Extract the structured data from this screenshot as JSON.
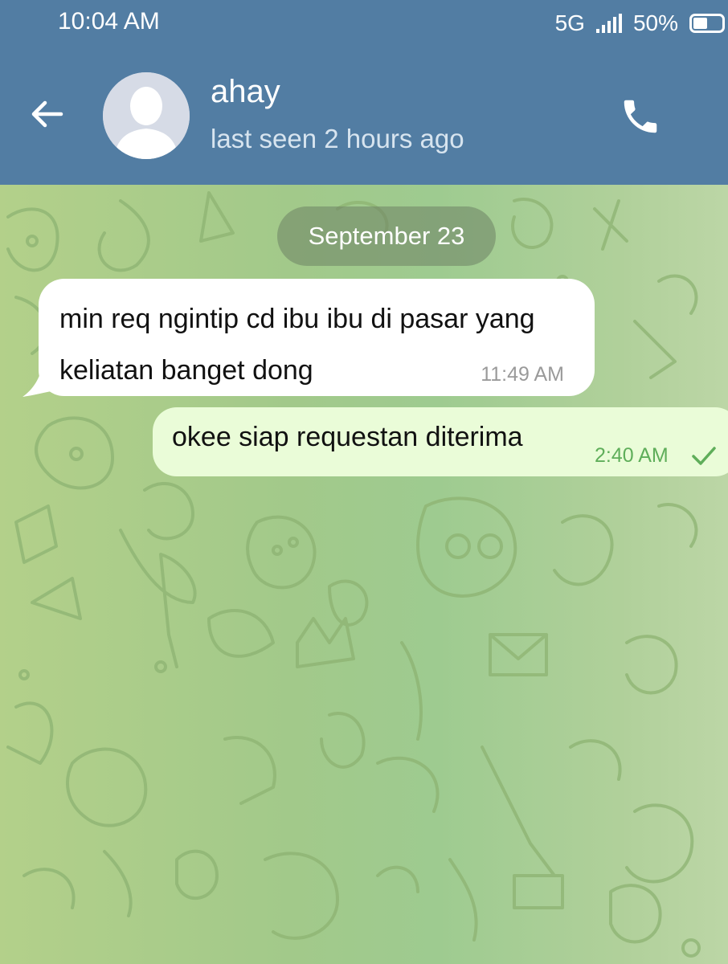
{
  "status_bar": {
    "time": "10:04 AM",
    "network": "5G",
    "battery": "50%"
  },
  "header": {
    "contact_name": "ahay",
    "contact_status": "last seen 2 hours ago",
    "back_icon": "arrow-left-icon",
    "call_icon": "phone-icon"
  },
  "chat": {
    "date_separator": "September 23",
    "messages": [
      {
        "direction": "incoming",
        "text": "min req ngintip cd ibu ibu di pasar yang keliatan banget dong",
        "time": "11:49 AM"
      },
      {
        "direction": "outgoing",
        "text": "okee siap requestan diterima",
        "time": "2:40 AM",
        "status_icon": "check-icon"
      }
    ]
  },
  "colors": {
    "header_bg": "#527da3",
    "incoming_bubble": "#ffffff",
    "outgoing_bubble": "#eafcd8",
    "outgoing_time": "#5fae5a",
    "wallpaper": "#a7c88a"
  }
}
